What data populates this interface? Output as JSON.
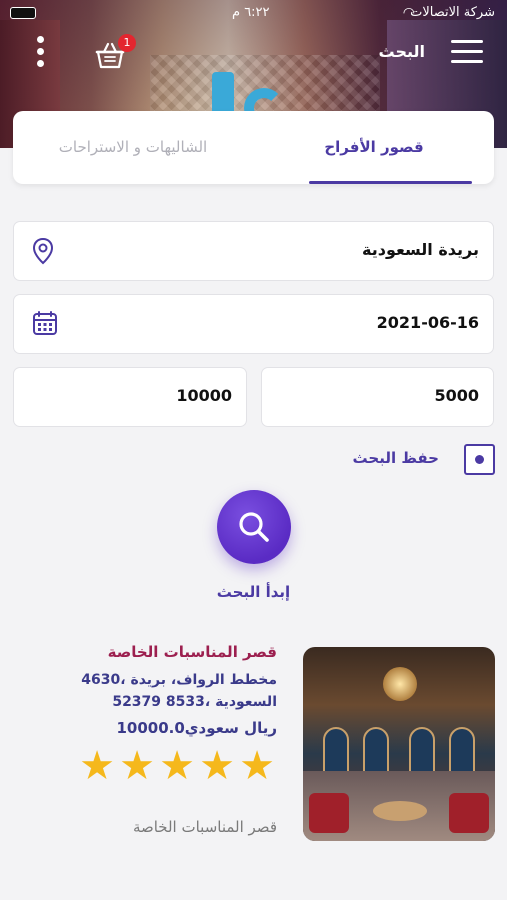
{
  "status_bar": {
    "carrier": "شركة الاتصالات",
    "time": "٦:٢٢ م"
  },
  "header": {
    "title": "البحث",
    "cart_badge": "1"
  },
  "tabs": [
    {
      "label": "قصور الأفراح",
      "active": true
    },
    {
      "label": "الشاليهات و الاستراحات",
      "active": false
    }
  ],
  "search_form": {
    "city": "بريدة السعودية",
    "date": "2021-06-16",
    "price_min": "5000",
    "price_max": "10000",
    "save_search_label": "حفظ البحث",
    "save_search_checked": true
  },
  "search_button": {
    "caption": "إبدأ البحث"
  },
  "results": [
    {
      "name": "قصر المناسبات الخاصة",
      "address_line1": "4630، مخطط الرواف، بريدة",
      "address_line2": "52379 8533، السعودية",
      "price": "10000.0ريال سعودي",
      "rating": 5,
      "subtitle": "قصر المناسبات الخاصة"
    }
  ],
  "colors": {
    "accent": "#4b3aa3",
    "title": "#9c1f4f",
    "star": "#f5b81c",
    "badge": "#e3262f"
  },
  "icons": {
    "menu": "hamburger-icon",
    "cart": "basket-icon",
    "more": "kebab-icon",
    "location": "location-pin-icon",
    "calendar": "calendar-icon",
    "search": "search-icon"
  }
}
